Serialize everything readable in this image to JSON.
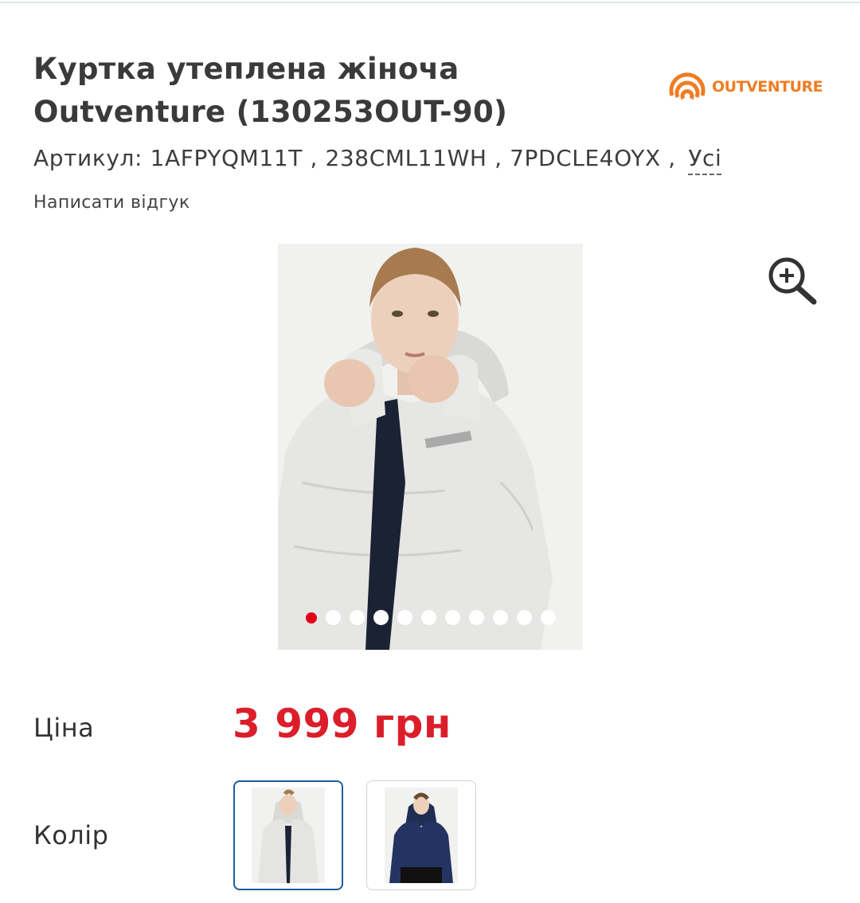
{
  "product": {
    "title_line1": "Куртка утеплена жіноча",
    "title_line2": "Outventure (130253OUT-90)",
    "brand": "OUTVENTURE",
    "sku_label": "Артикул:",
    "sku_values": "1AFPYQM11T , 238CML11WH , 7PDCLE4OYX ,",
    "sku_all_link": "Усі",
    "review_link": "Написати відгук"
  },
  "gallery": {
    "image": "woman-white-puffer-jacket-photo",
    "total_slides": 11,
    "active_slide": 1,
    "zoom_icon": "zoom-in-icon"
  },
  "price": {
    "label": "Ціна",
    "value": "3 999 грн"
  },
  "color": {
    "label": "Колір",
    "options": [
      {
        "image": "white-jacket-thumbnail",
        "selected": true
      },
      {
        "image": "navy-jacket-thumbnail",
        "selected": false
      }
    ]
  },
  "colors": {
    "accent_red": "#dc1e2b",
    "brand_orange": "#f07c22",
    "selected_border": "#1f5c9c"
  }
}
